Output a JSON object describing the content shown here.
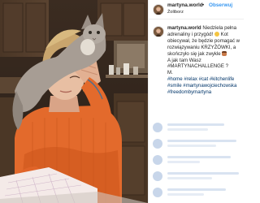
{
  "header": {
    "username": "martyna.world",
    "separator": "•",
    "follow_label": "Obserwuj",
    "location": "Żoliborz"
  },
  "caption": {
    "username": "martyna.world",
    "line1": "Niedziela pełna",
    "line2": "adrenaliny i przygód!",
    "line3": "Kot",
    "line4": "obiecywał, że będzie pomagać w",
    "line5": "rozwiązywaniu KRZYŻÓWKI, a",
    "line6": "skończyło się jak zwykle",
    "line7": "A jak tam Wasz",
    "line8": "#MARTYNACHALLENGE ?",
    "line9": "M.",
    "tags1": "#home #relax #cat #kitchenlife",
    "tags2": "#smile #martynawojciechowska",
    "tags3": "#freedombymartyna"
  },
  "colors": {
    "follow": "#3897f0",
    "hashtag": "#003569",
    "text": "#262626",
    "blur": "#d9e3f1"
  }
}
